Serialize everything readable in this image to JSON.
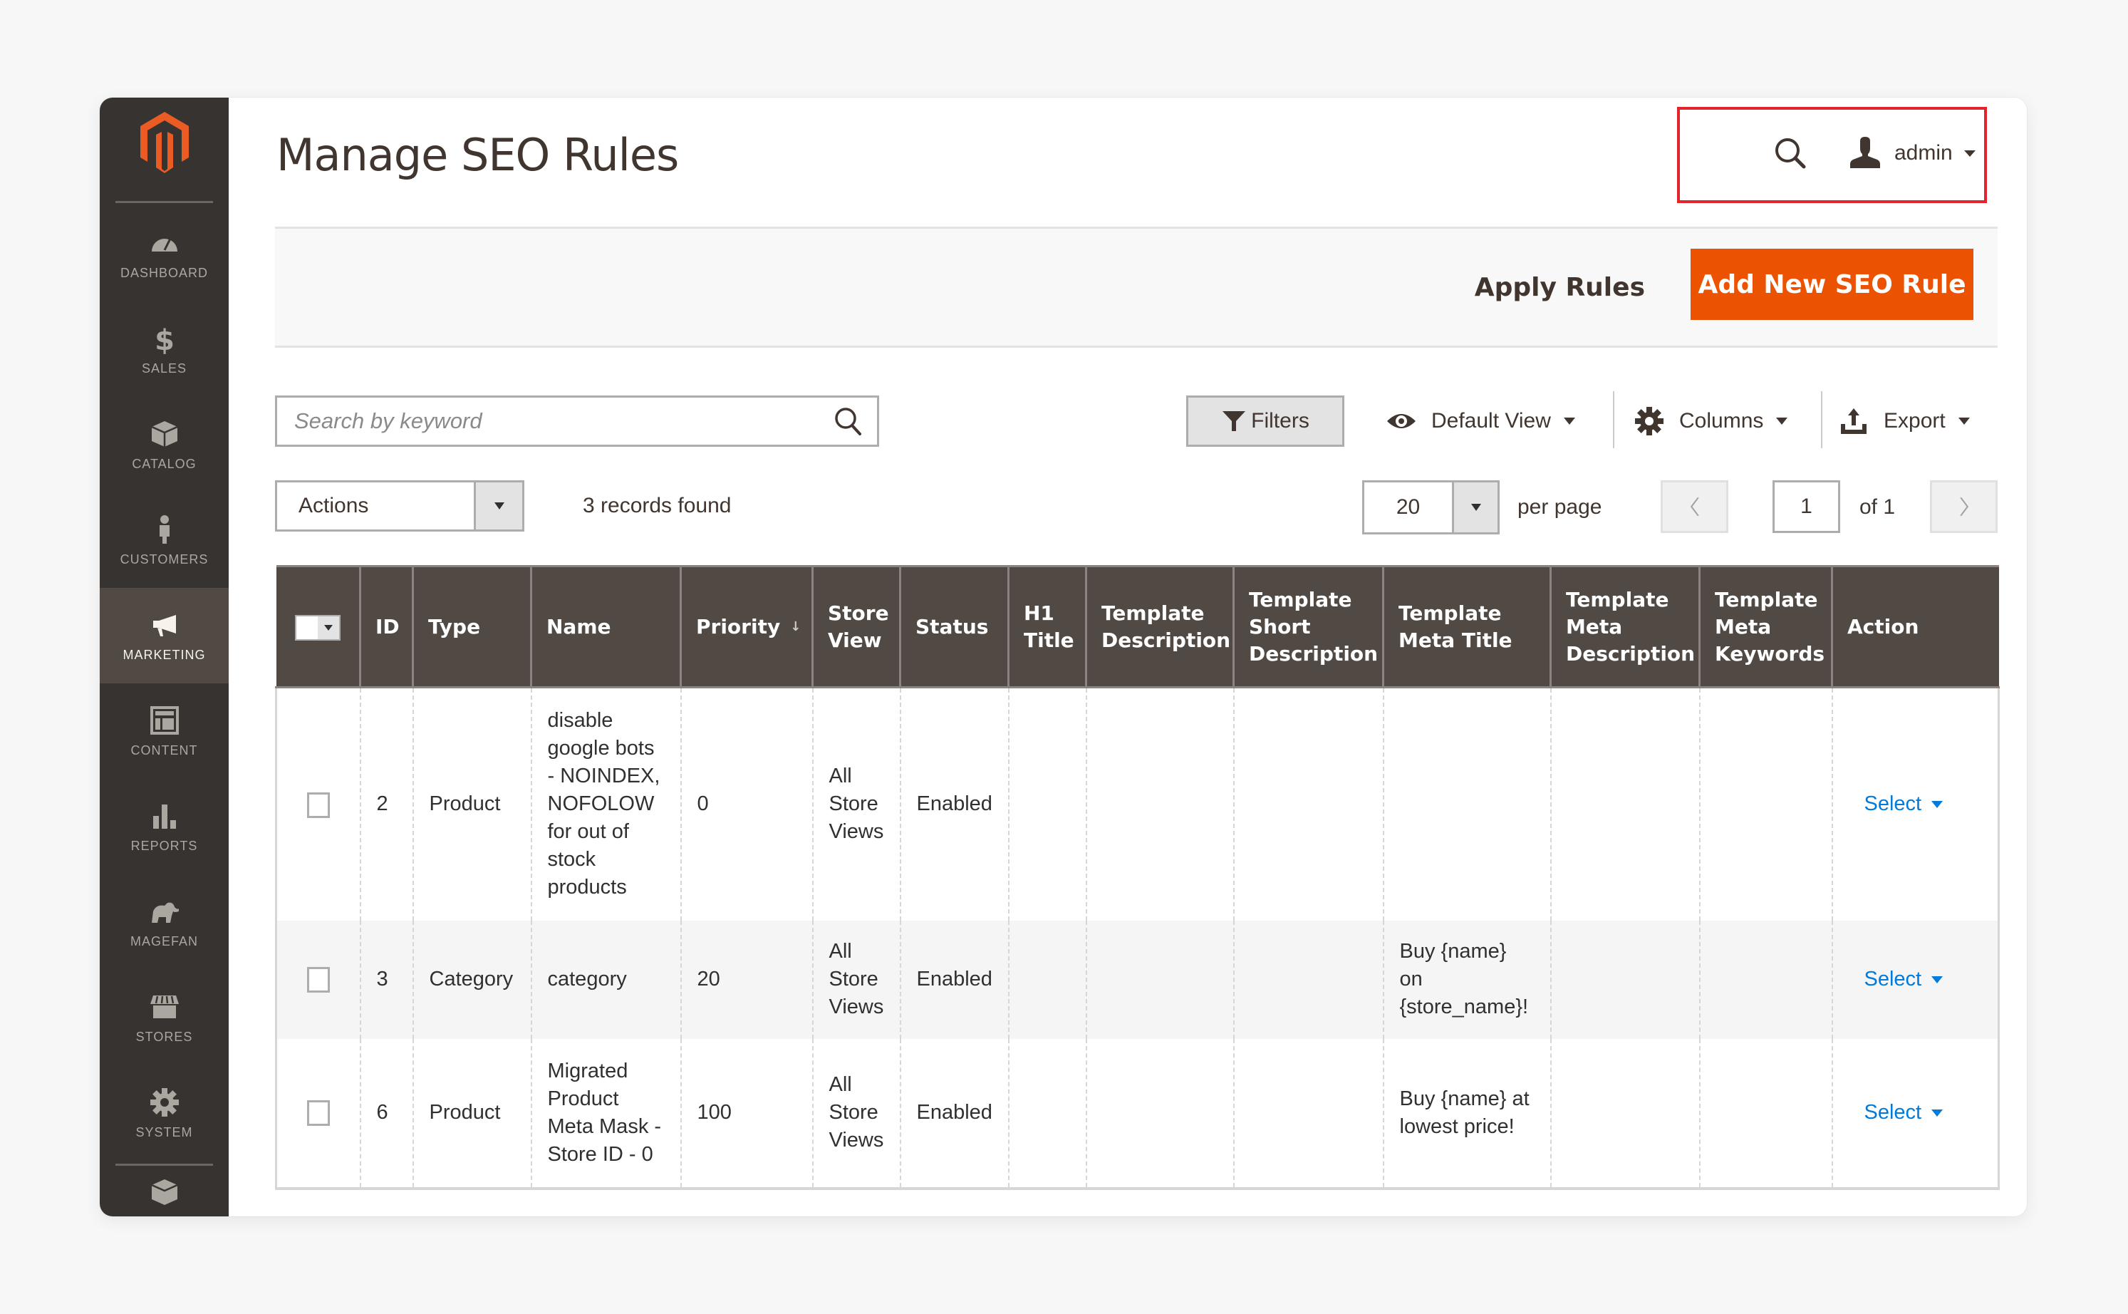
{
  "sidebar": {
    "logo": "magento-logo",
    "items": [
      {
        "label": "Dashboard",
        "icon": "dashboard-icon",
        "active": false
      },
      {
        "label": "Sales",
        "icon": "dollar-icon",
        "active": false
      },
      {
        "label": "Catalog",
        "icon": "box-icon",
        "active": false
      },
      {
        "label": "Customers",
        "icon": "person-icon",
        "active": false
      },
      {
        "label": "Marketing",
        "icon": "megaphone-icon",
        "active": true
      },
      {
        "label": "Content",
        "icon": "layout-icon",
        "active": false
      },
      {
        "label": "Reports",
        "icon": "bar-chart-icon",
        "active": false
      },
      {
        "label": "Magefan",
        "icon": "elephant-icon",
        "active": false
      },
      {
        "label": "Stores",
        "icon": "storefront-icon",
        "active": false
      },
      {
        "label": "System",
        "icon": "gear-icon",
        "active": false
      }
    ],
    "extra_icon": "extensions-icon"
  },
  "header": {
    "title": "Manage SEO Rules",
    "user": "admin"
  },
  "actions": {
    "apply_rules": "Apply Rules",
    "add_new": "Add New SEO Rule"
  },
  "toolbar": {
    "search_placeholder": "Search by keyword",
    "search_value": "",
    "filters": "Filters",
    "default_view": "Default View",
    "columns": "Columns",
    "export": "Export",
    "mass_actions": "Actions",
    "records_found": "3 records found",
    "per_page_value": "20",
    "per_page_label": "per page",
    "current_page": "1",
    "of_pages": "of 1"
  },
  "grid": {
    "columns": [
      "ID",
      "Type",
      "Name",
      "Priority",
      "Store View",
      "Status",
      "H1 Title",
      "Template Description",
      "Template Short Description",
      "Template Meta Title",
      "Template Meta Description",
      "Template Meta Keywords",
      "Action"
    ],
    "sorted_column": "Priority",
    "rows": [
      {
        "id": "2",
        "type": "Product",
        "name": "disable google bots - NOINDEX, NOFOLOW for out of stock products",
        "priority": "0",
        "store_view": "All Store Views",
        "status": "Enabled",
        "h1_title": "",
        "template_description": "",
        "template_short_description": "",
        "template_meta_title": "",
        "template_meta_description": "",
        "template_meta_keywords": "",
        "action": "Select"
      },
      {
        "id": "3",
        "type": "Category",
        "name": "category",
        "priority": "20",
        "store_view": "All Store Views",
        "status": "Enabled",
        "h1_title": "",
        "template_description": "",
        "template_short_description": "",
        "template_meta_title": "Buy {name} on {store_name}!",
        "template_meta_description": "",
        "template_meta_keywords": "",
        "action": "Select"
      },
      {
        "id": "6",
        "type": "Product",
        "name": "Migrated Product Meta Mask - Store ID - 0",
        "priority": "100",
        "store_view": "All Store Views",
        "status": "Enabled",
        "h1_title": "",
        "template_description": "",
        "template_short_description": "",
        "template_meta_title": "Buy {name} at lowest price!",
        "template_meta_description": "",
        "template_meta_keywords": "",
        "action": "Select"
      }
    ]
  },
  "colors": {
    "brand_orange": "#eb5202",
    "sidebar_bg": "#373330",
    "sidebar_active": "#514943",
    "table_header": "#514943",
    "link_blue": "#007bdb",
    "highlight_red": "#e0252e"
  }
}
